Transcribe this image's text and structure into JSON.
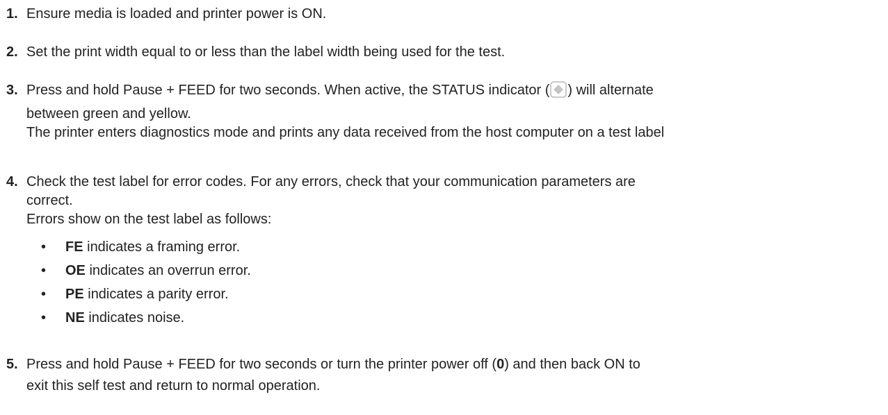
{
  "steps": [
    {
      "number": "1.",
      "text": "Ensure media is loaded and printer power is ON."
    },
    {
      "number": "2.",
      "text": "Set the print width equal to or less than the label width being used for the test."
    },
    {
      "number": "3.",
      "text_before_icon": "Press and hold Pause + FEED for two seconds. When active, the STATUS indicator (",
      "text_after_icon": ") will alternate",
      "line2": "between green and yellow.",
      "line3": "The printer enters diagnostics mode and prints any data received from the host computer on a test label",
      "icon": "status-indicator-icon"
    },
    {
      "number": "4.",
      "line1": "Check the test label for error codes. For any errors, check that your communication parameters are",
      "line2": "correct.",
      "line3": "Errors show on the test label as follows:",
      "bullets": [
        {
          "code": "FE",
          "desc": " indicates a framing error."
        },
        {
          "code": "OE",
          "desc": " indicates an overrun error."
        },
        {
          "code": "PE",
          "desc": " indicates a parity error."
        },
        {
          "code": "NE",
          "desc": " indicates noise."
        }
      ],
      "bullet_symbol": "•"
    },
    {
      "number": "5.",
      "line1_before": "Press and hold Pause + FEED for two seconds or turn the printer power off (",
      "line1_bold": "0",
      "line1_after": ") and then back ON to",
      "line2": "exit this self test and return to normal operation."
    }
  ],
  "colors": {
    "text": "#222222",
    "icon_border": "#b8b8b8",
    "icon_fill": "#c4c4c4"
  }
}
